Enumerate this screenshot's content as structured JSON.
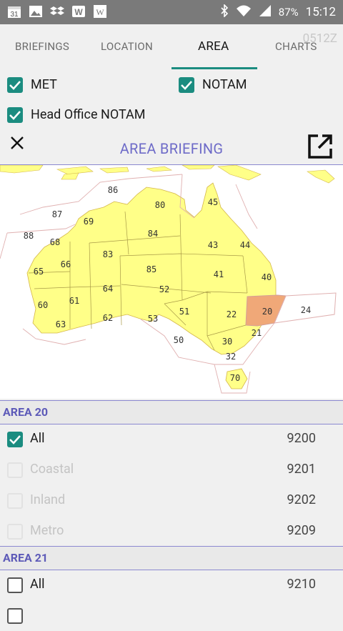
{
  "status_bar": {
    "calendar_day": "31",
    "battery": "87%",
    "time": "15:12"
  },
  "tabs": [
    "BRIEFINGS",
    "LOCATION",
    "AREA",
    "CHARTS"
  ],
  "active_tab": "AREA",
  "zulu_time": "0512Z",
  "filters": {
    "met": {
      "label": "MET",
      "checked": true
    },
    "notam": {
      "label": "NOTAM",
      "checked": true
    },
    "head_office": {
      "label": "Head Office NOTAM",
      "checked": true
    }
  },
  "briefing_title": "AREA BRIEFING",
  "map": {
    "selected_area": "20",
    "area_labels": [
      "86",
      "87",
      "88",
      "69",
      "68",
      "65",
      "66",
      "60",
      "61",
      "63",
      "62",
      "64",
      "83",
      "84",
      "85",
      "80",
      "45",
      "43",
      "44",
      "41",
      "40",
      "52",
      "51",
      "53",
      "50",
      "22",
      "20",
      "24",
      "21",
      "30",
      "32",
      "70"
    ]
  },
  "area20": {
    "header": "AREA 20",
    "rows": [
      {
        "label": "All",
        "code": "9200",
        "checked": true,
        "enabled": true
      },
      {
        "label": "Coastal",
        "code": "9201",
        "checked": false,
        "enabled": false
      },
      {
        "label": "Inland",
        "code": "9202",
        "checked": false,
        "enabled": false
      },
      {
        "label": "Metro",
        "code": "9209",
        "checked": false,
        "enabled": false
      }
    ]
  },
  "area21": {
    "header": "AREA 21",
    "rows": [
      {
        "label": "All",
        "code": "9210",
        "checked": false,
        "enabled": true
      }
    ]
  },
  "colors": {
    "accent": "#1b8c80",
    "header_text": "#5d5ab8",
    "land": "#ffff88",
    "selected_area": "#f0a878"
  }
}
